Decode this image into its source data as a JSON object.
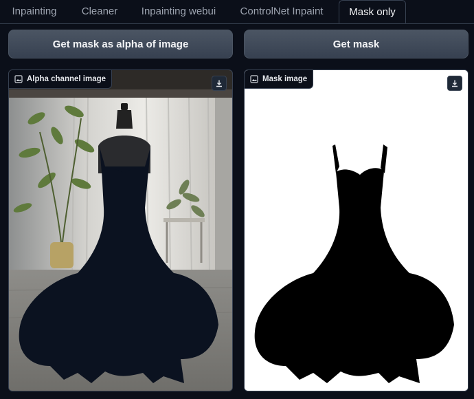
{
  "tabs": [
    {
      "label": "Inpainting",
      "active": false
    },
    {
      "label": "Cleaner",
      "active": false
    },
    {
      "label": "Inpainting webui",
      "active": false
    },
    {
      "label": "ControlNet Inpaint",
      "active": false
    },
    {
      "label": "Mask only",
      "active": true
    }
  ],
  "buttons": {
    "alpha": "Get mask as alpha of image",
    "mask": "Get mask"
  },
  "panels": {
    "alpha": {
      "label": "Alpha channel image",
      "icon": "image-icon",
      "download_icon": "download-icon"
    },
    "mask": {
      "label": "Mask image",
      "icon": "image-icon",
      "download_icon": "download-icon"
    }
  },
  "colors": {
    "background": "#0b0f19",
    "button": "#4b5563",
    "border": "#374151",
    "mask_fill": "#000000",
    "dress_fill": "#0b1220"
  }
}
